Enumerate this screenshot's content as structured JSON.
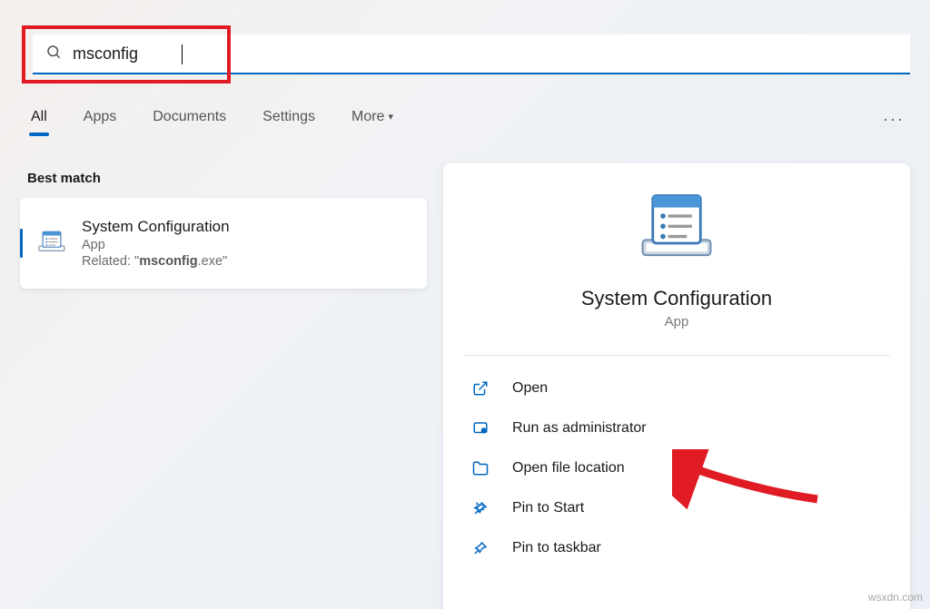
{
  "search": {
    "query": "msconfig"
  },
  "tabs": {
    "all": "All",
    "apps": "Apps",
    "documents": "Documents",
    "settings": "Settings",
    "more": "More"
  },
  "section": {
    "best_match": "Best match"
  },
  "result": {
    "title": "System Configuration",
    "type": "App",
    "related_prefix": "Related: \"",
    "related_bold": "msconfig",
    "related_suffix": ".exe\""
  },
  "panel": {
    "title": "System Configuration",
    "subtitle": "App"
  },
  "actions": {
    "open": "Open",
    "run_admin": "Run as administrator",
    "open_location": "Open file location",
    "pin_start": "Pin to Start",
    "pin_taskbar": "Pin to taskbar"
  },
  "watermark": "wsxdn.com"
}
